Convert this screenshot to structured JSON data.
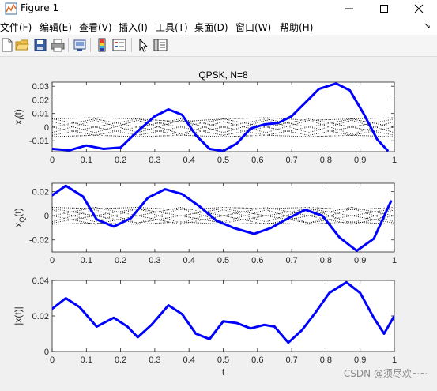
{
  "window": {
    "title": "Figure 1",
    "controls": {
      "minimize": "—",
      "maximize": "☐",
      "close": "✕"
    }
  },
  "menu": {
    "items": [
      "文件(F)",
      "编辑(E)",
      "查看(V)",
      "插入(I)",
      "工具(T)",
      "桌面(D)",
      "窗口(W)",
      "帮助(H)"
    ],
    "pin": "↘"
  },
  "toolbar": {
    "icons": [
      "new-figure-icon",
      "open-file-icon",
      "save-icon",
      "print-icon",
      "link-plot-icon",
      "insert-colorbar-icon",
      "insert-legend-icon",
      "edit-plot-arrow-icon",
      "property-inspector-icon"
    ]
  },
  "colors": {
    "accent": "#0000ff",
    "dotted": "#000000",
    "axes_bg": "#ffffff",
    "figure_bg": "#f0f0f0"
  },
  "watermark": "CSDN @须尽欢~~",
  "chart_data": [
    {
      "type": "line",
      "title": "QPSK, N=8",
      "xlabel": "",
      "ylabel": "x_I(t)",
      "ylabel_main": "x",
      "ylabel_sub": "I",
      "ylabel_tail": "(t)",
      "xlim": [
        0,
        1
      ],
      "ylim": [
        -0.018,
        0.033
      ],
      "xticks": [
        0,
        0.1,
        0.2,
        0.3,
        0.4,
        0.5,
        0.6,
        0.7,
        0.8,
        0.9,
        1
      ],
      "xtick_labels": [
        "0",
        "0.1",
        "0.2",
        "0.3",
        "0.4",
        "0.5",
        "0.6",
        "0.7",
        "0.8",
        "0.9",
        "1"
      ],
      "yticks": [
        -0.01,
        0,
        0.01,
        0.02,
        0.03
      ],
      "ytick_labels": [
        "-0.01",
        "0",
        "0.01",
        "0.02",
        "0.03"
      ],
      "series": [
        {
          "style": "solid",
          "color": "#0000ff",
          "x": [
            0,
            0.05,
            0.1,
            0.15,
            0.2,
            0.25,
            0.3,
            0.34,
            0.38,
            0.42,
            0.46,
            0.5,
            0.54,
            0.58,
            0.62,
            0.66,
            0.7,
            0.74,
            0.78,
            0.83,
            0.87,
            0.91,
            0.95,
            0.98
          ],
          "y": [
            -0.016,
            -0.017,
            -0.0135,
            -0.016,
            -0.015,
            -0.003,
            0.008,
            0.013,
            0.009,
            -0.006,
            -0.016,
            -0.0175,
            -0.012,
            -0.001,
            0.002,
            0.003,
            0.008,
            0.018,
            0.028,
            0.032,
            0.027,
            0.01,
            -0.009,
            -0.017
          ]
        },
        {
          "style": "dotted",
          "x": [
            0,
            0.125,
            0.25,
            0.375,
            0.5,
            0.625,
            0.75,
            0.875,
            1
          ],
          "y": [
            0.006,
            0.007,
            0.006,
            0.004,
            0.006,
            0.007,
            0.005,
            0.006,
            0.007
          ]
        },
        {
          "style": "dotted",
          "x": [
            0,
            0.125,
            0.25,
            0.375,
            0.5,
            0.625,
            0.75,
            0.875,
            1
          ],
          "y": [
            -0.007,
            -0.006,
            -0.007,
            -0.006,
            -0.007,
            -0.006,
            -0.007,
            -0.006,
            -0.007
          ]
        },
        {
          "style": "dotted",
          "x": [
            0,
            0.125,
            0.25,
            0.375,
            0.5,
            0.625,
            0.75,
            0.875,
            1
          ],
          "y": [
            0.004,
            -0.004,
            0.005,
            -0.005,
            0.004,
            -0.004,
            0.005,
            -0.005,
            0.004
          ]
        },
        {
          "style": "dotted",
          "x": [
            0,
            0.125,
            0.25,
            0.375,
            0.5,
            0.625,
            0.75,
            0.875,
            1
          ],
          "y": [
            -0.004,
            0.005,
            -0.004,
            0.005,
            -0.004,
            0.005,
            -0.004,
            0.005,
            -0.004
          ]
        },
        {
          "style": "dotted",
          "x": [
            0,
            0.125,
            0.25,
            0.375,
            0.5,
            0.625,
            0.75,
            0.875,
            1
          ],
          "y": [
            0.0,
            0.006,
            0.0,
            -0.006,
            0.0,
            0.006,
            0.0,
            -0.006,
            0.0
          ]
        },
        {
          "style": "dotted",
          "x": [
            0,
            0.125,
            0.25,
            0.375,
            0.5,
            0.625,
            0.75,
            0.875,
            1
          ],
          "y": [
            0.0,
            -0.006,
            0.0,
            0.006,
            0.0,
            -0.006,
            0.0,
            0.006,
            0.0
          ]
        },
        {
          "style": "dotted",
          "x": [
            0,
            0.125,
            0.25,
            0.375,
            0.5,
            0.625,
            0.75,
            0.875,
            1
          ],
          "y": [
            -0.006,
            0.0,
            0.006,
            0.0,
            -0.006,
            0.0,
            0.006,
            0.0,
            -0.006
          ]
        },
        {
          "style": "dotted",
          "x": [
            0,
            0.125,
            0.25,
            0.375,
            0.5,
            0.625,
            0.75,
            0.875,
            1
          ],
          "y": [
            0.006,
            0.0,
            -0.006,
            0.0,
            0.006,
            0.0,
            -0.006,
            0.0,
            0.006
          ]
        }
      ]
    },
    {
      "type": "line",
      "title": "",
      "xlabel": "",
      "ylabel": "x_Q(t)",
      "ylabel_main": "x",
      "ylabel_sub": "Q",
      "ylabel_tail": "(t)",
      "xlim": [
        0,
        1
      ],
      "ylim": [
        -0.03,
        0.027
      ],
      "xticks": [
        0,
        0.1,
        0.2,
        0.3,
        0.4,
        0.5,
        0.6,
        0.7,
        0.8,
        0.9,
        1
      ],
      "xtick_labels": [
        "0",
        "0.1",
        "0.2",
        "0.3",
        "0.4",
        "0.5",
        "0.6",
        "0.7",
        "0.8",
        "0.9",
        "1"
      ],
      "yticks": [
        -0.02,
        0,
        0.02
      ],
      "ytick_labels": [
        "-0.02",
        "0",
        "0.02"
      ],
      "series": [
        {
          "style": "solid",
          "color": "#0000ff",
          "x": [
            0,
            0.04,
            0.09,
            0.13,
            0.18,
            0.23,
            0.28,
            0.33,
            0.38,
            0.43,
            0.48,
            0.53,
            0.59,
            0.64,
            0.69,
            0.74,
            0.79,
            0.84,
            0.89,
            0.94,
            0.99
          ],
          "y": [
            0.017,
            0.025,
            0.016,
            -0.003,
            -0.009,
            -0.002,
            0.015,
            0.022,
            0.018,
            0.008,
            -0.004,
            -0.01,
            -0.015,
            -0.01,
            -0.002,
            0.005,
            0.0,
            -0.018,
            -0.029,
            -0.019,
            0.012
          ]
        },
        {
          "style": "dotted",
          "x": [
            0,
            0.125,
            0.25,
            0.375,
            0.5,
            0.625,
            0.75,
            0.875,
            1
          ],
          "y": [
            0.007,
            0.006,
            0.007,
            0.005,
            0.007,
            0.006,
            0.007,
            0.005,
            0.007
          ]
        },
        {
          "style": "dotted",
          "x": [
            0,
            0.125,
            0.25,
            0.375,
            0.5,
            0.625,
            0.75,
            0.875,
            1
          ],
          "y": [
            -0.007,
            -0.006,
            -0.007,
            -0.005,
            -0.007,
            -0.006,
            -0.007,
            -0.005,
            -0.007
          ]
        },
        {
          "style": "dotted",
          "x": [
            0,
            0.125,
            0.25,
            0.375,
            0.5,
            0.625,
            0.75,
            0.875,
            1
          ],
          "y": [
            0.005,
            -0.005,
            0.006,
            -0.006,
            0.005,
            -0.005,
            0.006,
            -0.006,
            0.005
          ]
        },
        {
          "style": "dotted",
          "x": [
            0,
            0.125,
            0.25,
            0.375,
            0.5,
            0.625,
            0.75,
            0.875,
            1
          ],
          "y": [
            -0.005,
            0.005,
            -0.006,
            0.006,
            -0.005,
            0.005,
            -0.006,
            0.006,
            -0.005
          ]
        },
        {
          "style": "dotted",
          "x": [
            0,
            0.125,
            0.25,
            0.375,
            0.5,
            0.625,
            0.75,
            0.875,
            1
          ],
          "y": [
            0.0,
            0.007,
            0.0,
            -0.007,
            0.0,
            0.007,
            0.0,
            -0.007,
            0.0
          ]
        },
        {
          "style": "dotted",
          "x": [
            0,
            0.125,
            0.25,
            0.375,
            0.5,
            0.625,
            0.75,
            0.875,
            1
          ],
          "y": [
            0.0,
            -0.007,
            0.0,
            0.007,
            0.0,
            -0.007,
            0.0,
            0.007,
            0.0
          ]
        },
        {
          "style": "dotted",
          "x": [
            0,
            0.125,
            0.25,
            0.375,
            0.5,
            0.625,
            0.75,
            0.875,
            1
          ],
          "y": [
            -0.006,
            0.0,
            0.006,
            0.0,
            -0.006,
            0.0,
            0.006,
            0.0,
            -0.006
          ]
        },
        {
          "style": "dotted",
          "x": [
            0,
            0.125,
            0.25,
            0.375,
            0.5,
            0.625,
            0.75,
            0.875,
            1
          ],
          "y": [
            0.006,
            0.0,
            -0.006,
            0.0,
            0.006,
            0.0,
            -0.006,
            0.0,
            0.006
          ]
        }
      ]
    },
    {
      "type": "line",
      "title": "",
      "xlabel": "t",
      "ylabel": "|x(t)|",
      "xlim": [
        0,
        1
      ],
      "ylim": [
        0,
        0.04
      ],
      "xticks": [
        0,
        0.1,
        0.2,
        0.3,
        0.4,
        0.5,
        0.6,
        0.7,
        0.8,
        0.9,
        1
      ],
      "xtick_labels": [
        "0",
        "0.1",
        "0.2",
        "0.3",
        "0.4",
        "0.5",
        "0.6",
        "0.7",
        "0.8",
        "0.9",
        "1"
      ],
      "yticks": [
        0,
        0.02,
        0.04
      ],
      "ytick_labels": [
        "0",
        "0.02",
        "0.04"
      ],
      "series": [
        {
          "style": "solid",
          "color": "#0000ff",
          "x": [
            0,
            0.04,
            0.08,
            0.13,
            0.18,
            0.22,
            0.25,
            0.29,
            0.34,
            0.38,
            0.42,
            0.46,
            0.5,
            0.54,
            0.58,
            0.62,
            0.65,
            0.69,
            0.73,
            0.77,
            0.81,
            0.86,
            0.9,
            0.94,
            0.97,
            1.0
          ],
          "y": [
            0.024,
            0.03,
            0.025,
            0.014,
            0.019,
            0.014,
            0.008,
            0.015,
            0.026,
            0.021,
            0.01,
            0.007,
            0.017,
            0.016,
            0.013,
            0.015,
            0.014,
            0.005,
            0.012,
            0.022,
            0.033,
            0.039,
            0.033,
            0.019,
            0.01,
            0.02
          ]
        }
      ]
    }
  ]
}
